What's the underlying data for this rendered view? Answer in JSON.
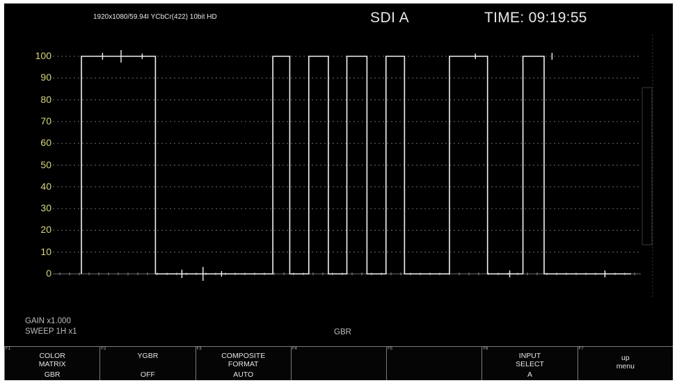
{
  "header": {
    "format": "1920x1080/59.94I YCbCr(422) 10bit HD",
    "input": "SDI A",
    "time": "TIME: 09:19:55"
  },
  "scale": {
    "labels": [
      "100",
      "90",
      "80",
      "70",
      "60",
      "50",
      "40",
      "30",
      "20",
      "10",
      "0"
    ]
  },
  "waveform": {
    "y_range": [
      0,
      100
    ],
    "pulses_pct": [
      [
        0.0,
        0.14
      ],
      [
        0.362,
        0.394
      ],
      [
        0.43,
        0.467
      ],
      [
        0.502,
        0.54
      ],
      [
        0.576,
        0.611
      ],
      [
        0.696,
        0.768
      ],
      [
        0.835,
        0.875
      ]
    ],
    "high_level": 100,
    "low_level": 0
  },
  "status": {
    "gain": "GAIN x1.000",
    "sweep": "SWEEP 1H x1",
    "mode": "GBR"
  },
  "function_keys": [
    {
      "num": "F1",
      "line1": "COLOR",
      "line2": "MATRIX",
      "line3": "GBR"
    },
    {
      "num": "F2",
      "line1": "YGBR",
      "line2": "",
      "line3": "OFF"
    },
    {
      "num": "F3",
      "line1": "COMPOSITE",
      "line2": "FORMAT",
      "line3": "AUTO"
    },
    {
      "num": "F4",
      "line1": "",
      "line2": "",
      "line3": ""
    },
    {
      "num": "F5",
      "line1": "",
      "line2": "",
      "line3": ""
    },
    {
      "num": "F6",
      "line1": "INPUT",
      "line2": "SELECT",
      "line3": "A"
    },
    {
      "num": "F7",
      "line1": "up",
      "line2": "menu",
      "line3": ""
    }
  ],
  "colors": {
    "background": "#000000",
    "trace": "#f2f2f2",
    "scale_text": "#d6d680",
    "graticule": "#6e6e6e"
  }
}
